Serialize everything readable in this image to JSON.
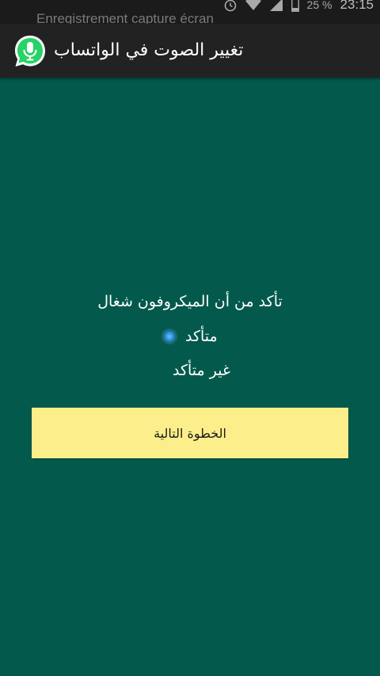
{
  "status_bar": {
    "notification_text": "Enregistrement capture écran",
    "battery": "25 %",
    "time": "23:15",
    "icons": [
      "alarm-icon",
      "wifi-icon",
      "signal-icon",
      "battery-icon"
    ]
  },
  "app_bar": {
    "title": "تغيير الصوت في الواتساب",
    "icon": "whatsapp-mic-icon",
    "icon_color": "#25d366"
  },
  "main": {
    "question": "تأكد من أن الميكروفون شغال",
    "options": [
      {
        "label": "متأكد",
        "selected": true
      },
      {
        "label": "غير متأكد",
        "selected": false
      }
    ],
    "next_button_label": "الخطوة التالية"
  },
  "colors": {
    "background": "#035a4c",
    "button": "#fcee8a",
    "app_bar": "#222222"
  }
}
